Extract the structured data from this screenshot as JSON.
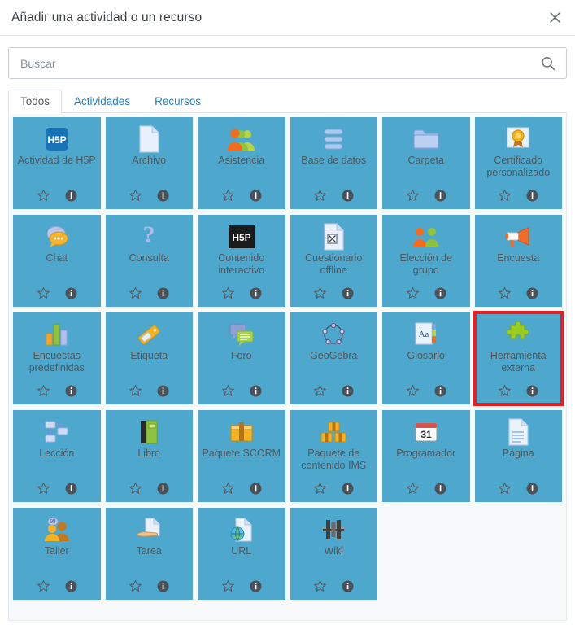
{
  "modal": {
    "title": "Añadir una actividad o un recurso",
    "close_label": "×"
  },
  "search": {
    "placeholder": "Buscar",
    "value": "",
    "icon": "search-icon"
  },
  "tabs": [
    {
      "label": "Todos",
      "active": true
    },
    {
      "label": "Actividades",
      "active": false
    },
    {
      "label": "Recursos",
      "active": false
    }
  ],
  "colors": {
    "card_background": "#4ea7cd",
    "highlight_border": "#ee1c1c",
    "tab_link": "#2c7cbf",
    "grid_background": "#f7f9fa",
    "label_text": "#50595f"
  },
  "card_actions": {
    "favorite_icon": "star-outline-icon",
    "info_icon": "info-circle-icon"
  },
  "items": [
    {
      "label": "Actividad de H5P",
      "icon": "h5p-blue-icon",
      "highlighted": false
    },
    {
      "label": "Archivo",
      "icon": "file-page-icon",
      "highlighted": false
    },
    {
      "label": "Asistencia",
      "icon": "attendance-people-icon",
      "highlighted": false
    },
    {
      "label": "Base de datos",
      "icon": "database-stack-icon",
      "highlighted": false
    },
    {
      "label": "Carpeta",
      "icon": "folder-icon",
      "highlighted": false
    },
    {
      "label": "Certificado personalizado",
      "icon": "certificate-medal-icon",
      "highlighted": false
    },
    {
      "label": "Chat",
      "icon": "chat-bubbles-icon",
      "highlighted": false
    },
    {
      "label": "Consulta",
      "icon": "question-mark-icon",
      "highlighted": false
    },
    {
      "label": "Contenido interactivo",
      "icon": "h5p-black-icon",
      "highlighted": false
    },
    {
      "label": "Cuestionario offline",
      "icon": "offline-quiz-icon",
      "highlighted": false
    },
    {
      "label": "Elección de grupo",
      "icon": "group-choice-icon",
      "highlighted": false
    },
    {
      "label": "Encuesta",
      "icon": "megaphone-icon",
      "highlighted": false
    },
    {
      "label": "Encuestas predefinidas",
      "icon": "bar-chart-icon",
      "highlighted": false
    },
    {
      "label": "Etiqueta",
      "icon": "tag-label-icon",
      "highlighted": false
    },
    {
      "label": "Foro",
      "icon": "forum-speech-icon",
      "highlighted": false
    },
    {
      "label": "GeoGebra",
      "icon": "geogebra-icon",
      "highlighted": false
    },
    {
      "label": "Glosario",
      "icon": "glossary-aa-icon",
      "highlighted": false
    },
    {
      "label": "Herramienta externa",
      "icon": "puzzle-piece-icon",
      "highlighted": true
    },
    {
      "label": "Lección",
      "icon": "lesson-flow-icon",
      "highlighted": false
    },
    {
      "label": "Libro",
      "icon": "book-icon",
      "highlighted": false
    },
    {
      "label": "Paquete SCORM",
      "icon": "scorm-package-icon",
      "highlighted": false
    },
    {
      "label": "Paquete de contenido IMS",
      "icon": "ims-packages-icon",
      "highlighted": false
    },
    {
      "label": "Programador",
      "icon": "calendar-31-icon",
      "highlighted": false
    },
    {
      "label": "Página",
      "icon": "page-document-icon",
      "highlighted": false
    },
    {
      "label": "Taller",
      "icon": "workshop-people-icon",
      "highlighted": false
    },
    {
      "label": "Tarea",
      "icon": "assignment-hand-icon",
      "highlighted": false
    },
    {
      "label": "URL",
      "icon": "url-globe-icon",
      "highlighted": false
    },
    {
      "label": "Wiki",
      "icon": "wiki-icon",
      "highlighted": false
    }
  ]
}
